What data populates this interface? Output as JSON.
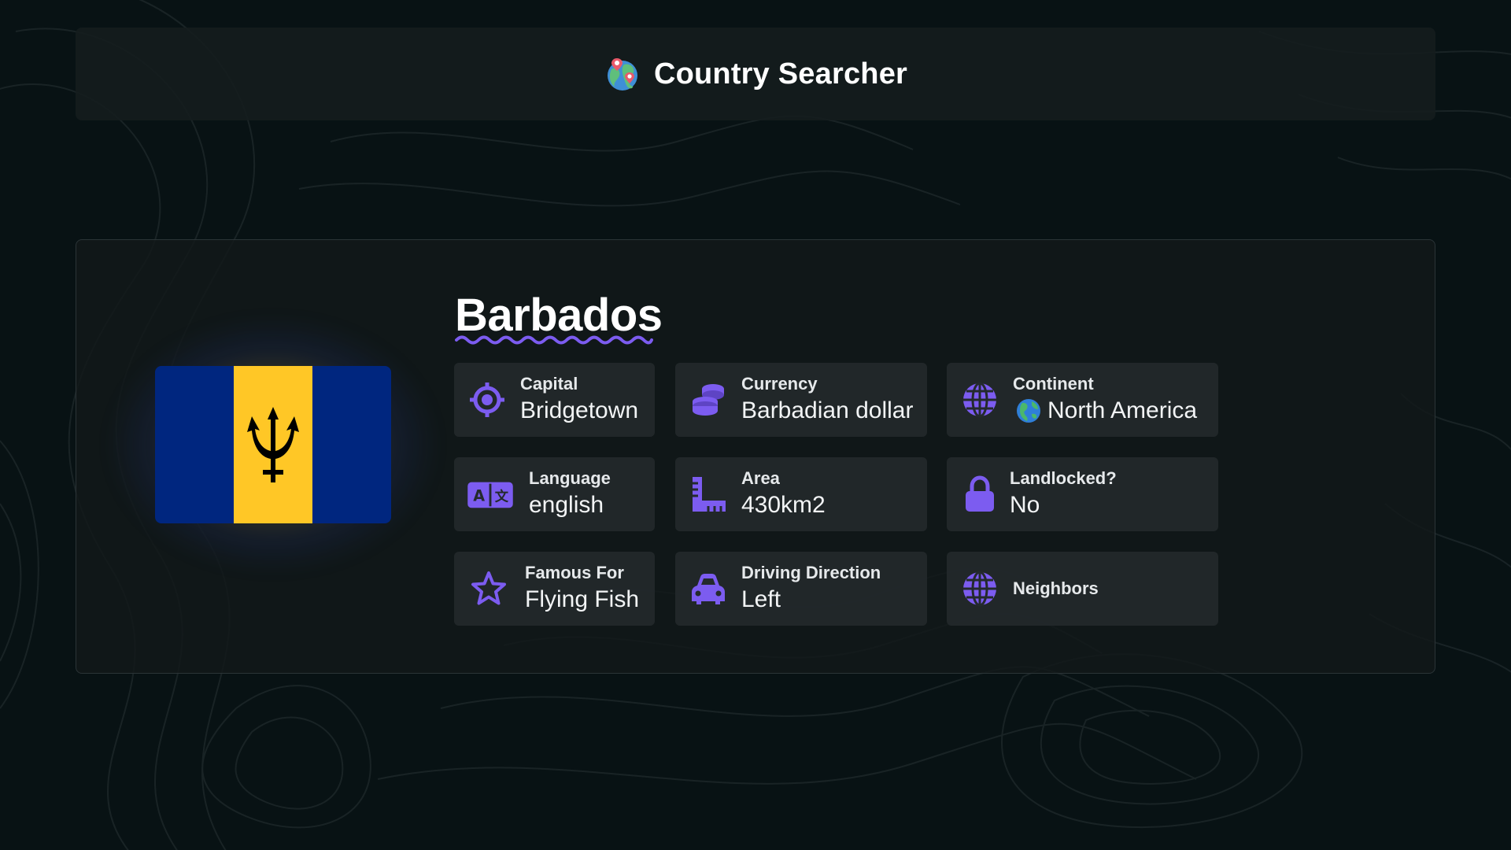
{
  "header": {
    "title": "Country Searcher",
    "logo_icon": "globe-with-pins-icon"
  },
  "country": {
    "name": "Barbados",
    "flag": {
      "colors": {
        "blue": "#00267f",
        "gold": "#ffc726",
        "trident": "#000000"
      },
      "emblem": "trident"
    }
  },
  "cards": {
    "capital": {
      "label": "Capital",
      "value": "Bridgetown",
      "icon": "crosshair-icon"
    },
    "currency": {
      "label": "Currency",
      "value": "Barbadian dollar",
      "icon": "coins-icon"
    },
    "continent": {
      "label": "Continent",
      "value": "North America",
      "icon": "globe-icon",
      "value_icon": "earth-americas-icon"
    },
    "language": {
      "label": "Language",
      "value": "english",
      "icon": "translate-icon"
    },
    "area": {
      "label": "Area",
      "value": "430km2",
      "icon": "ruler-icon"
    },
    "landlocked": {
      "label": "Landlocked?",
      "value": "No",
      "icon": "lock-icon"
    },
    "famous_for": {
      "label": "Famous For",
      "value": "Flying Fish",
      "icon": "star-icon"
    },
    "driving_direction": {
      "label": "Driving Direction",
      "value": "Left",
      "icon": "car-icon"
    },
    "neighbors": {
      "label": "Neighbors",
      "icon": "globe-icon"
    }
  },
  "theme": {
    "accent": "#7c5cf0",
    "background": "#081214",
    "panel": "#12181a",
    "card": "#242a2d"
  }
}
